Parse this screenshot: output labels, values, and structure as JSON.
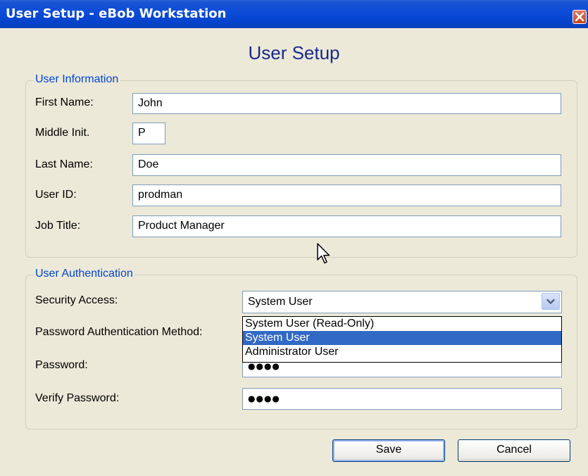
{
  "window": {
    "title": "User Setup - eBob Workstation",
    "heading": "User Setup"
  },
  "user_info": {
    "legend": "User Information",
    "first_name_label": "First Name:",
    "first_name": "John",
    "middle_init_label": "Middle Init.",
    "middle_init": "P",
    "last_name_label": "Last Name:",
    "last_name": "Doe",
    "user_id_label": "User ID:",
    "user_id": "prodman",
    "job_title_label": "Job Title:",
    "job_title": "Product Manager"
  },
  "auth": {
    "legend": "User Authentication",
    "security_label": "Security Access:",
    "security_value": "System User",
    "security_options": [
      "System User (Read-Only)",
      "System User",
      "Administrator User"
    ],
    "method_label": "Password Authentication Method:",
    "password_label": "Password:",
    "password_mask": "●●●●",
    "verify_label": "Verify Password:",
    "verify_mask": "●●●●"
  },
  "buttons": {
    "save": "Save",
    "cancel": "Cancel"
  },
  "colors": {
    "titlebar": "#0a4bd8",
    "heading": "#1a2a8c",
    "legend": "#0046d5",
    "selection": "#316ac5",
    "dialog_bg": "#ece9d8"
  },
  "icons": {
    "close": "close-icon",
    "dropdown": "chevron-down-icon",
    "cursor": "mouse-cursor-icon"
  }
}
